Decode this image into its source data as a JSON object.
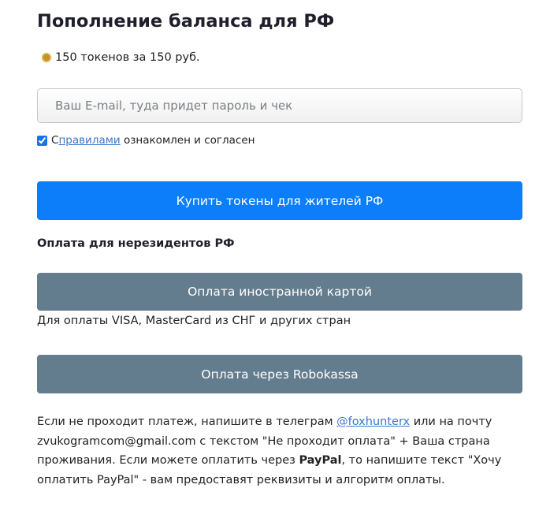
{
  "page": {
    "title": "Пополнение баланса для РФ"
  },
  "price": {
    "icon": "coin-icon",
    "text": "150 токенов за 150 руб."
  },
  "email": {
    "placeholder": "Ваш E-mail, туда придет пароль и чек",
    "value": ""
  },
  "agreement": {
    "checked": true,
    "prefix": "С ",
    "link_text": "правилами",
    "suffix": " ознакомлен и согласен"
  },
  "buy_button": {
    "label": "Купить токены для жителей РФ",
    "color": "#0d7ef9"
  },
  "nonresident": {
    "heading": "Оплата для нерезидентов РФ",
    "foreign_card_button": "Оплата иностранной картой",
    "foreign_card_note": "Для оплаты VISA, MasterCard из СНГ и других стран",
    "robokassa_button": "Оплата через Robokassa",
    "button_color": "#647d8e"
  },
  "support": {
    "part1": "Если не проходит платеж, напишите в телеграм ",
    "telegram_link": "@foxhunterx",
    "part2": " или на почту zvukogramcom@gmail.com с текстом \"Не проходит оплата\" + Ваша страна проживания. Если можете оплатить через ",
    "paypal": "PayPal",
    "part3": ", то напишите текст \"Хочу оплатить PayPal\" - вам предоставят реквизиты и алгоритм оплаты."
  }
}
